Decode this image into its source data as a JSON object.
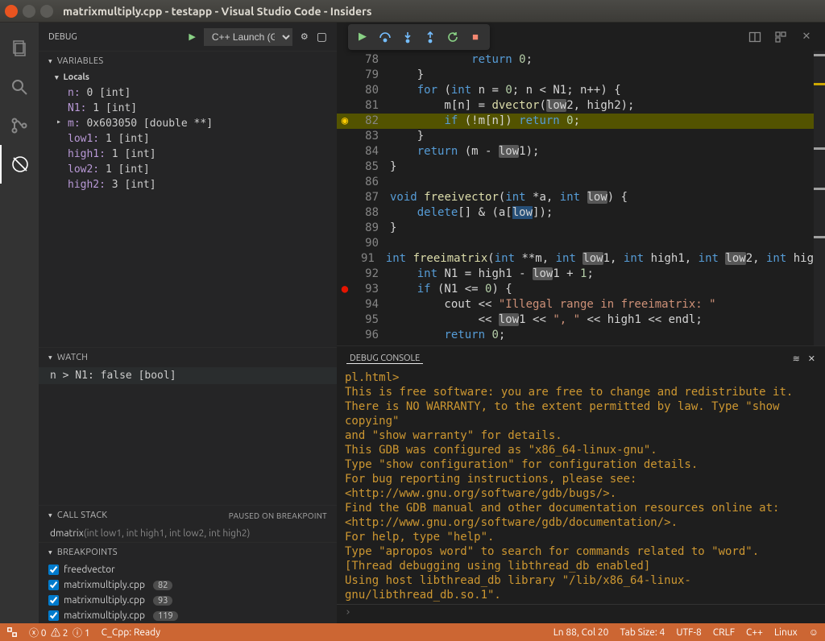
{
  "window": {
    "title": "matrixmultiply.cpp - testapp - Visual Studio Code - Insiders"
  },
  "sidebar": {
    "debug_label": "DEBUG",
    "config": "C++ Launch (G",
    "sections": {
      "variables": "VARIABLES",
      "locals": "Locals",
      "watch": "WATCH",
      "callstack": "CALL STACK",
      "cs_status": "PAUSED ON BREAKPOINT",
      "breakpoints": "BREAKPOINTS"
    },
    "vars": [
      {
        "k": "n:",
        "v": " 0 [int]"
      },
      {
        "k": "N1:",
        "v": " 1 [int]"
      },
      {
        "k": "m:",
        "v": " 0x603050 [double **]",
        "exp": true
      },
      {
        "k": "low1:",
        "v": " 1 [int]"
      },
      {
        "k": "high1:",
        "v": " 1 [int]"
      },
      {
        "k": "low2:",
        "v": " 1 [int]"
      },
      {
        "k": "high2:",
        "v": " 3 [int]"
      }
    ],
    "watch": [
      {
        "expr": "n > N1: false [bool]"
      }
    ],
    "callstack": [
      {
        "fn": "dmatrix",
        "args": "(int low1, int high1, int low2, int high2)"
      }
    ],
    "breakpoints": [
      {
        "label": "freedvector",
        "badge": ""
      },
      {
        "label": "matrixmultiply.cpp",
        "badge": "82"
      },
      {
        "label": "matrixmultiply.cpp",
        "badge": "93"
      },
      {
        "label": "matrixmultiply.cpp",
        "badge": "119"
      }
    ]
  },
  "editor": {
    "lines": [
      {
        "n": 78,
        "html": "            <span class='kw'>return</span> <span class='num'>0</span>;"
      },
      {
        "n": 79,
        "html": "    }"
      },
      {
        "n": 80,
        "html": "    <span class='kw'>for</span> (<span class='typ'>int</span> n = <span class='num'>0</span>; n &lt; N1; n++) {"
      },
      {
        "n": 81,
        "html": "        m[n] = <span class='fn'>dvector</span>(<span class='hl-word'>low</span>2, high2);"
      },
      {
        "n": 82,
        "html": "        <span class='kw'>if</span> (!m[n]) <span class='kw'>return</span> <span class='num'>0</span>;",
        "bp": "active",
        "exec": true
      },
      {
        "n": 83,
        "html": "    }"
      },
      {
        "n": 84,
        "html": "    <span class='kw'>return</span> (m - <span class='hl-word'>low</span>1);"
      },
      {
        "n": 85,
        "html": "}"
      },
      {
        "n": 86,
        "html": ""
      },
      {
        "n": 87,
        "html": "<span class='typ'>void</span> <span class='fn'>freeivector</span>(<span class='typ'>int</span> *a, <span class='typ'>int</span> <span class='hl-word'>low</span>) {"
      },
      {
        "n": 88,
        "html": "    <span class='kw'>delete</span>[] &amp; (a[<span class='hl-sel'>low</span>]);",
        "cursor": true
      },
      {
        "n": 89,
        "html": "}"
      },
      {
        "n": 90,
        "html": ""
      },
      {
        "n": 91,
        "html": "<span class='typ'>int</span> <span class='fn'>freeimatrix</span>(<span class='typ'>int</span> **m, <span class='typ'>int</span> <span class='hl-word'>low</span>1, <span class='typ'>int</span> high1, <span class='typ'>int</span> <span class='hl-word'>low</span>2, <span class='typ'>int</span> hig"
      },
      {
        "n": 92,
        "html": "    <span class='typ'>int</span> N1 = high1 - <span class='hl-word'>low</span>1 + <span class='num'>1</span>;"
      },
      {
        "n": 93,
        "html": "    <span class='kw'>if</span> (N1 &lt;= <span class='num'>0</span>) {",
        "bp": "normal"
      },
      {
        "n": 94,
        "html": "        cout &lt;&lt; <span class='str'>\"Illegal range in freeimatrix: \"</span>"
      },
      {
        "n": 95,
        "html": "             &lt;&lt; <span class='hl-word'>low</span>1 &lt;&lt; <span class='str'>\", \"</span> &lt;&lt; high1 &lt;&lt; endl;"
      },
      {
        "n": 96,
        "html": "        <span class='kw'>return</span> <span class='num'>0</span>;"
      }
    ]
  },
  "panel": {
    "title": "DEBUG CONSOLE",
    "lines": [
      "pl.html>",
      "This is free software: you are free to change and redistribute it.",
      "There is NO WARRANTY, to the extent permitted by law.  Type \"show copying\"",
      "and \"show warranty\" for details.",
      "This GDB was configured as \"x86_64-linux-gnu\".",
      "Type \"show configuration\" for configuration details.",
      "For bug reporting instructions, please see:",
      "<http://www.gnu.org/software/gdb/bugs/>.",
      "Find the GDB manual and other documentation resources online at:",
      "<http://www.gnu.org/software/gdb/documentation/>.",
      "For help, type \"help\".",
      "Type \"apropos word\" to search for commands related to \"word\".",
      "[Thread debugging using libthread_db enabled]",
      "Using host libthread_db library \"/lib/x86_64-linux-gnu/libthread_db.so.1\"."
    ],
    "prompt": "›"
  },
  "status": {
    "errors": "0",
    "warnings": "2",
    "info": "1",
    "ext": "C_Cpp: Ready",
    "pos": "Ln 88, Col 20",
    "tab": "Tab Size: 4",
    "enc": "UTF-8",
    "eol": "CRLF",
    "lang": "C++",
    "os": "Linux"
  }
}
